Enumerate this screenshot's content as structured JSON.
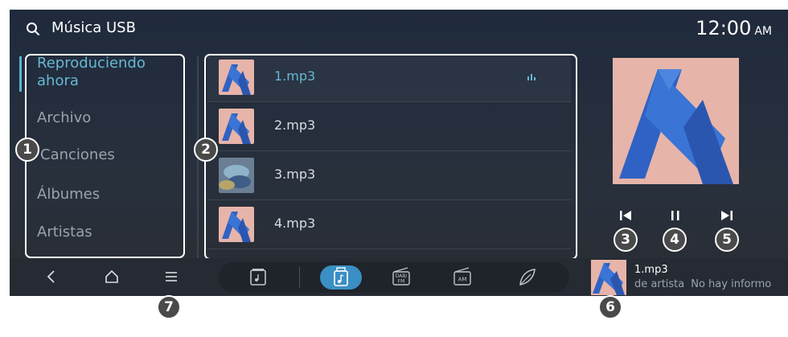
{
  "header": {
    "title": "Música USB",
    "time": "12:00",
    "ampm": "AM"
  },
  "sidebar": {
    "items": [
      {
        "label_line1": "Reproduciendo",
        "label_line2": "ahora",
        "active": true
      },
      {
        "label": "Archivo"
      },
      {
        "label": "Canciones"
      },
      {
        "label": "Álbumes"
      },
      {
        "label": "Artistas"
      }
    ]
  },
  "tracks": [
    {
      "name": "1.mp3",
      "playing": true,
      "thumb": "album-art"
    },
    {
      "name": "2.mp3",
      "thumb": "album-art"
    },
    {
      "name": "3.mp3",
      "thumb": "photo"
    },
    {
      "name": "4.mp3",
      "thumb": "album-art"
    }
  ],
  "controls": {
    "previous": "skip-previous-icon",
    "pause": "pause-icon",
    "next": "skip-next-icon"
  },
  "bottom_nav": [
    "back-icon",
    "home-icon",
    "menu-icon"
  ],
  "sources": [
    "media-icon",
    "usb-music-icon",
    "dab-fm-icon",
    "am-radio-icon",
    "leaf-icon"
  ],
  "source_labels": {
    "dab_top": "DAB/",
    "dab_bottom": "FM",
    "am": "AM"
  },
  "mini_player": {
    "title": "1.mp3",
    "artist": "de artista",
    "album": "No hay informo"
  },
  "callouts": [
    "1",
    "2",
    "3",
    "4",
    "5",
    "6",
    "7"
  ],
  "colors": {
    "accent": "#66b8d4",
    "active_source": "#3a8fc4",
    "art_blue": "#2f62c4",
    "art_pink": "#e7b4a9"
  }
}
